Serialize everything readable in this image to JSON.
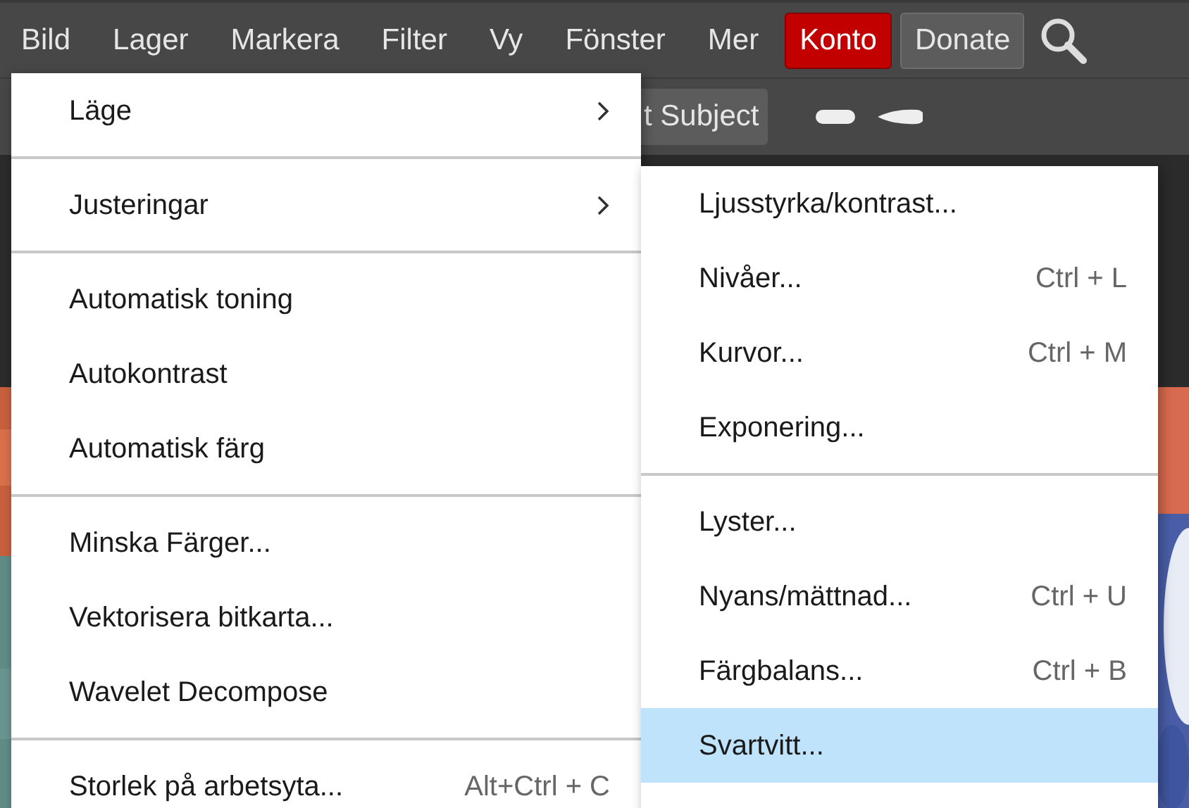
{
  "menubar": [
    {
      "label": "Bild",
      "kind": "menu"
    },
    {
      "label": "Lager",
      "kind": "menu"
    },
    {
      "label": "Markera",
      "kind": "menu"
    },
    {
      "label": "Filter",
      "kind": "menu"
    },
    {
      "label": "Vy",
      "kind": "menu"
    },
    {
      "label": "Fönster",
      "kind": "menu"
    },
    {
      "label": "Mer",
      "kind": "menu"
    },
    {
      "label": "Konto",
      "kind": "account"
    },
    {
      "label": "Donate",
      "kind": "donate"
    }
  ],
  "toolbar": {
    "subject_button": "t Subject"
  },
  "image_menu": [
    [
      {
        "label": "Läge",
        "submenu": true
      }
    ],
    [
      {
        "label": "Justeringar",
        "submenu": true
      }
    ],
    [
      {
        "label": "Automatisk toning"
      },
      {
        "label": "Autokontrast"
      },
      {
        "label": "Automatisk färg"
      }
    ],
    [
      {
        "label": "Minska Färger..."
      },
      {
        "label": "Vektorisera bitkarta..."
      },
      {
        "label": "Wavelet Decompose"
      }
    ],
    [
      {
        "label": "Storlek på arbetsyta...",
        "shortcut": "Alt+Ctrl + C"
      }
    ]
  ],
  "adjustments_menu": [
    [
      {
        "label": "Ljusstyrka/kontrast...",
        "selected": false
      },
      {
        "label": "Nivåer...",
        "shortcut": "Ctrl + L",
        "selected": false
      },
      {
        "label": "Kurvor...",
        "shortcut": "Ctrl + M",
        "selected": false
      },
      {
        "label": "Exponering...",
        "selected": false
      }
    ],
    [
      {
        "label": "Lyster...",
        "selected": false
      },
      {
        "label": "Nyans/mättnad...",
        "shortcut": "Ctrl + U",
        "selected": false
      },
      {
        "label": "Färgbalans...",
        "shortcut": "Ctrl + B",
        "selected": false
      },
      {
        "label": "Svartvitt...",
        "selected": true
      }
    ]
  ]
}
